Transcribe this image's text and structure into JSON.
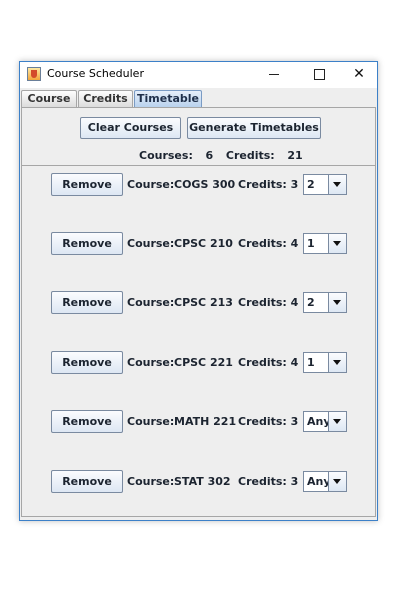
{
  "window": {
    "title": "Course Scheduler",
    "app_icon": "java-cup-icon",
    "controls": [
      "minimize-icon",
      "maximize-icon",
      "close-icon"
    ]
  },
  "tabs": [
    {
      "label": "Course",
      "selected": false
    },
    {
      "label": "Credits",
      "selected": false
    },
    {
      "label": "Timetable",
      "selected": true
    }
  ],
  "actions": {
    "clear_label": "Clear Courses",
    "generate_label": "Generate Timetables"
  },
  "summary": {
    "courses_label": "Courses:",
    "courses_value": "6",
    "credits_label": "Credits:",
    "credits_value": "21"
  },
  "rows": [
    {
      "remove_label": "Remove",
      "course_label": "Course:",
      "course": "COGS 300",
      "credits_label": "Credits: 3",
      "section": "2"
    },
    {
      "remove_label": "Remove",
      "course_label": "Course:",
      "course": "CPSC 210",
      "credits_label": "Credits: 4",
      "section": "1"
    },
    {
      "remove_label": "Remove",
      "course_label": "Course:",
      "course": "CPSC 213",
      "credits_label": "Credits: 4",
      "section": "2"
    },
    {
      "remove_label": "Remove",
      "course_label": "Course:",
      "course": "CPSC 221",
      "credits_label": "Credits: 4",
      "section": "1"
    },
    {
      "remove_label": "Remove",
      "course_label": "Course:",
      "course": "MATH 221",
      "credits_label": "Credits: 3",
      "section": "Any"
    },
    {
      "remove_label": "Remove",
      "course_label": "Course:",
      "course": "STAT 302",
      "credits_label": "Credits: 3",
      "section": "Any"
    }
  ]
}
